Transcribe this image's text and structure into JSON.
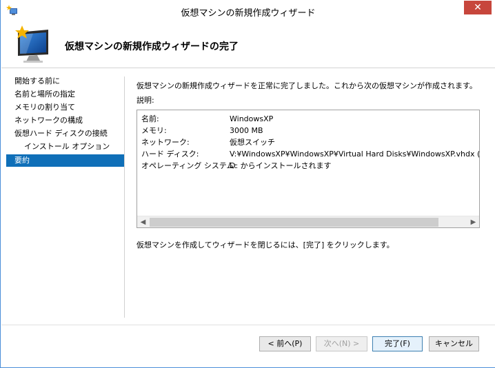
{
  "window": {
    "title": "仮想マシンの新規作成ウィザード",
    "close_glyph": "✕",
    "accent": "#c7463c"
  },
  "header": {
    "title": "仮想マシンの新規作成ウィザードの完了"
  },
  "nav": {
    "items": [
      {
        "label": "開始する前に",
        "selected": false
      },
      {
        "label": "名前と場所の指定",
        "selected": false
      },
      {
        "label": "メモリの割り当て",
        "selected": false
      },
      {
        "label": "ネットワークの構成",
        "selected": false
      },
      {
        "label": "仮想ハード ディスクの接続",
        "selected": false
      },
      {
        "label": "インストール オプション",
        "selected": false
      },
      {
        "label": "要約",
        "selected": true
      }
    ],
    "selected_color": "#0f6fb8"
  },
  "main": {
    "intro": "仮想マシンの新規作成ウィザードを正常に完了しました。これから次の仮想マシンが作成されます。",
    "description_label": "説明:",
    "summary": [
      {
        "key": "名前:",
        "value": "WindowsXP"
      },
      {
        "key": "メモリ:",
        "value": "3000 MB"
      },
      {
        "key": "ネットワーク:",
        "value": "仮想スイッチ"
      },
      {
        "key": "ハード ディスク:",
        "value": "V:¥WindowsXP¥WindowsXP¥Virtual Hard Disks¥WindowsXP.vhdx (VHDX、容"
      },
      {
        "key": "オペレーティング システム:",
        "value": "D: からインストールされます"
      }
    ],
    "outro": "仮想マシンを作成してウィザードを閉じるには、[完了] をクリックします。"
  },
  "buttons": {
    "back": "< 前へ(P)",
    "next": "次へ(N) >",
    "finish": "完了(F)",
    "cancel": "キャンセル"
  }
}
